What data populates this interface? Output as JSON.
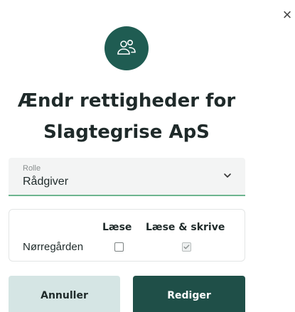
{
  "dialog": {
    "close_glyph": "×",
    "title_line1": "Ændr rettigheder for",
    "title_line2": "Slagtegrise ApS",
    "avatar_icon": "users-icon",
    "accent_color": "#1f5c52"
  },
  "role_select": {
    "label": "Rolle",
    "value": "Rådgiver"
  },
  "permissions": {
    "columns": [
      "Læse",
      "Læse & skrive"
    ],
    "rows": [
      {
        "label": "Nørregården",
        "read": false,
        "write": true,
        "write_disabled": true
      }
    ]
  },
  "buttons": {
    "cancel": "Annuller",
    "edit": "Rediger"
  }
}
